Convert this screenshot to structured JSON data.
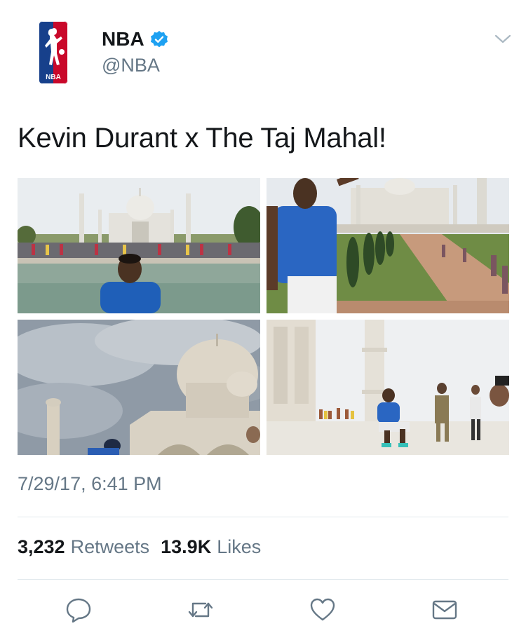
{
  "author": {
    "display_name": "NBA",
    "handle": "@NBA",
    "verified": true,
    "avatar_icon": "nba-logo-icon"
  },
  "tweet": {
    "text": "Kevin Durant x The Taj Mahal!",
    "timestamp": "7/29/17, 6:41 PM"
  },
  "photos": [
    {
      "name": "photo-durant-reflecting-pool"
    },
    {
      "name": "photo-durant-garden-path"
    },
    {
      "name": "photo-taj-mahal-dome-clouds"
    },
    {
      "name": "photo-durant-squat-marble-terrace"
    }
  ],
  "stats": {
    "retweets_count": "3,232",
    "retweets_label": "Retweets",
    "likes_count": "13.9K",
    "likes_label": "Likes"
  },
  "actions": [
    {
      "name": "reply",
      "icon": "reply-icon"
    },
    {
      "name": "retweet",
      "icon": "retweet-icon"
    },
    {
      "name": "like",
      "icon": "heart-icon"
    },
    {
      "name": "direct-message",
      "icon": "envelope-icon"
    }
  ],
  "colors": {
    "verified_blue": "#1da1f2",
    "secondary_text": "#657786",
    "icon_gray": "#657786",
    "nba_red": "#c9082a",
    "nba_blue": "#17408b"
  }
}
